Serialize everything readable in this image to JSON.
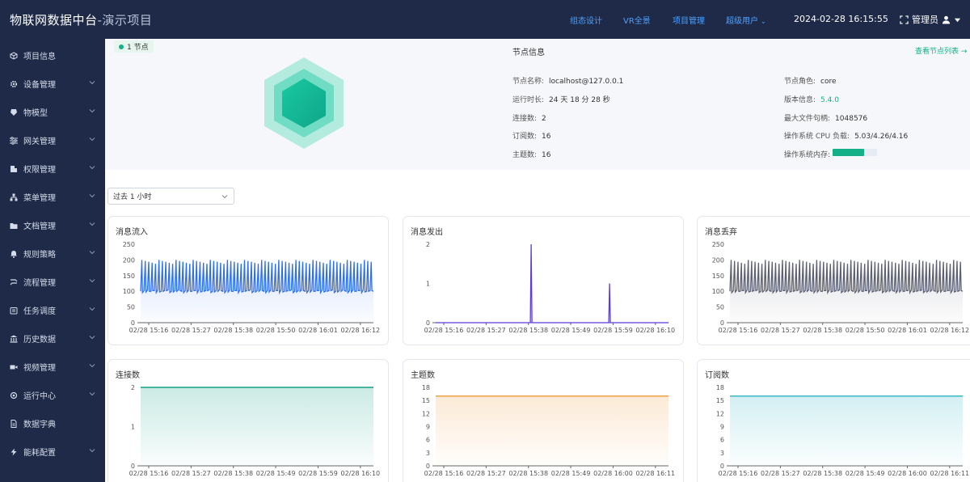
{
  "header": {
    "title_main": "物联网数据中台",
    "title_sub": "-演示项目",
    "nav": [
      "组态设计",
      "VR全景",
      "项目管理",
      "超级用户"
    ],
    "datetime": "2024-02-28 16:15:55",
    "user_label": "管理员",
    "nav_color": "#4ea1ff",
    "bg_color": "#1e2a48"
  },
  "sidebar": {
    "items": [
      {
        "label": "项目信息",
        "icon": "cube-icon",
        "expandable": false
      },
      {
        "label": "设备管理",
        "icon": "gear-icon",
        "expandable": true
      },
      {
        "label": "物模型",
        "icon": "model-icon",
        "expandable": true
      },
      {
        "label": "网关管理",
        "icon": "sliders-icon",
        "expandable": true
      },
      {
        "label": "权限管理",
        "icon": "shield-icon",
        "expandable": true
      },
      {
        "label": "菜单管理",
        "icon": "tree-icon",
        "expandable": true
      },
      {
        "label": "文档管理",
        "icon": "folder-icon",
        "expandable": true
      },
      {
        "label": "规则策略",
        "icon": "bell-icon",
        "expandable": true
      },
      {
        "label": "流程管理",
        "icon": "flow-icon",
        "expandable": true
      },
      {
        "label": "任务调度",
        "icon": "calendar-icon",
        "expandable": true
      },
      {
        "label": "历史数据",
        "icon": "bank-icon",
        "expandable": true
      },
      {
        "label": "视频管理",
        "icon": "video-icon",
        "expandable": true
      },
      {
        "label": "运行中心",
        "icon": "cog-icon",
        "expandable": true
      },
      {
        "label": "数据字典",
        "icon": "doc-icon",
        "expandable": false
      },
      {
        "label": "能耗配置",
        "icon": "bolt-icon",
        "expandable": true
      }
    ]
  },
  "node": {
    "badge": "1 节点",
    "title": "节点信息",
    "view_link": "查看节点列表 →",
    "left": [
      {
        "key": "节点名称:",
        "value": "localhost@127.0.0.1"
      },
      {
        "key": "运行时长:",
        "value": "24 天 18 分 28 秒"
      },
      {
        "key": "连接数:",
        "value": "2"
      },
      {
        "key": "订阅数:",
        "value": "16"
      },
      {
        "key": "主题数:",
        "value": "16"
      }
    ],
    "right": [
      {
        "key": "节点角色:",
        "value": "core"
      },
      {
        "key": "版本信息:",
        "value": "5.4.0"
      },
      {
        "key": "最大文件句柄:",
        "value": "1048576"
      },
      {
        "key": "操作系统 CPU 负载:",
        "value": "5.03/4.26/4.16"
      },
      {
        "key": "操作系统内存:",
        "value": ""
      }
    ],
    "memory_fraction": 0.7,
    "accent": "#14b088"
  },
  "filter": {
    "label": "过去 1 小时"
  },
  "chart_data": [
    {
      "type": "line",
      "title": "消息流入",
      "color": "#2f6fe8",
      "ylim": [
        0,
        250
      ],
      "yticks": [
        0,
        50,
        100,
        150,
        200,
        250
      ],
      "xticks": [
        "02/28 15:16",
        "02/28 15:27",
        "02/28 15:38",
        "02/28 15:50",
        "02/28 16:01",
        "02/28 16:12"
      ],
      "pattern": "spikes",
      "base": 100,
      "peak": 200,
      "count": 68
    },
    {
      "type": "line",
      "title": "消息发出",
      "color": "#5b3bd9",
      "ylim": [
        0,
        2
      ],
      "yticks": [
        0,
        1,
        2
      ],
      "xticks": [
        "02/28 15:16",
        "02/28 15:27",
        "02/28 15:38",
        "02/28 15:49",
        "02/28 15:59",
        "02/28 16:10"
      ],
      "pattern": "events",
      "events": [
        {
          "x": 0.41,
          "y": 2
        },
        {
          "x": 0.747,
          "y": 1
        }
      ]
    },
    {
      "type": "line",
      "title": "消息丢弃",
      "color": "#5c6072",
      "ylim": [
        0,
        250
      ],
      "yticks": [
        0,
        50,
        100,
        150,
        200,
        250
      ],
      "xticks": [
        "02/28 15:16",
        "02/28 15:27",
        "02/28 15:38",
        "02/28 15:50",
        "02/28 16:01",
        "02/28 16:12"
      ],
      "pattern": "spikes",
      "base": 100,
      "peak": 200,
      "count": 68
    },
    {
      "type": "area",
      "title": "连接数",
      "color": "#14a085",
      "ylim": [
        0,
        2
      ],
      "yticks": [
        0,
        1,
        2
      ],
      "xticks": [
        "02/28 15:16",
        "02/28 15:27",
        "02/28 15:38",
        "02/28 15:49",
        "02/28 15:59",
        "02/28 16:10"
      ],
      "pattern": "flat",
      "value": 2
    },
    {
      "type": "area",
      "title": "主题数",
      "color": "#f0a048",
      "ylim": [
        0,
        18
      ],
      "yticks": [
        0,
        3,
        6,
        9,
        12,
        15,
        18
      ],
      "xticks": [
        "02/28 15:16",
        "02/28 15:27",
        "02/28 15:38",
        "02/28 15:49",
        "02/28 16:00",
        "02/28 16:11"
      ],
      "pattern": "flat",
      "value": 16
    },
    {
      "type": "area",
      "title": "订阅数",
      "color": "#3ab8c8",
      "ylim": [
        0,
        18
      ],
      "yticks": [
        0,
        3,
        6,
        9,
        12,
        15,
        18
      ],
      "xticks": [
        "02/28 15:16",
        "02/28 15:27",
        "02/28 15:38",
        "02/28 15:49",
        "02/28 16:00",
        "02/28 16:11"
      ],
      "pattern": "flat",
      "value": 16
    }
  ]
}
